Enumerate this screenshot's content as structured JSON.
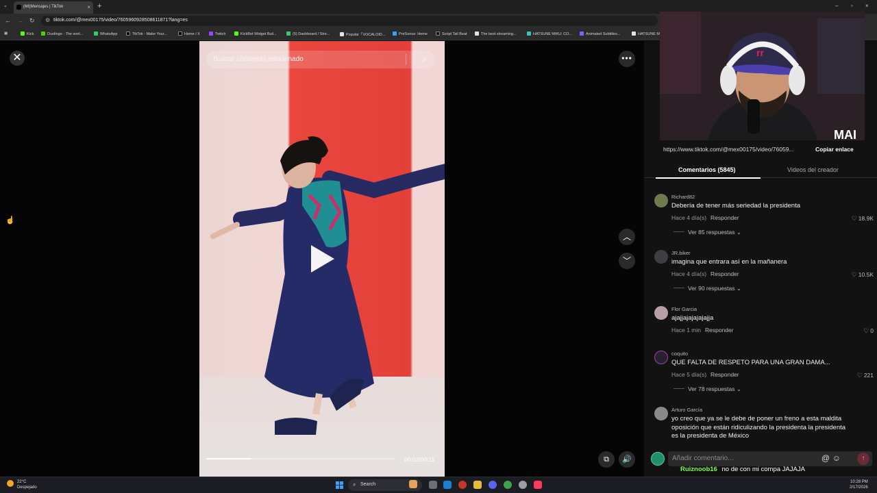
{
  "browser": {
    "tab_title": "(66)Mensajes | TikTok",
    "tab_close": "×",
    "new_tab": "+",
    "url": "tiktok.com/@mex00175/video/7605960928508611871?lang=es",
    "window_controls": [
      "–",
      "▫",
      "×"
    ],
    "bookmarks": [
      {
        "label": "Kick",
        "color": "#53fc18"
      },
      {
        "label": "Duolingo - The worl...",
        "color": "#58cc02"
      },
      {
        "label": "WhatsApp",
        "color": "#25d366"
      },
      {
        "label": "TikTok - Make Your...",
        "color": "#000000"
      },
      {
        "label": "Home / X",
        "color": "#000000"
      },
      {
        "label": "Twitch",
        "color": "#9146ff"
      },
      {
        "label": "KickBot Widget Buil...",
        "color": "#53fc18"
      },
      {
        "label": "(5) Dashboard / Stre...",
        "color": "#3ec46d"
      },
      {
        "label": "Popular「VOCALOID...",
        "color": "#e2e2e2"
      },
      {
        "label": "PreSonus: Home",
        "color": "#3aa0ff"
      },
      {
        "label": "Script Tail Beat",
        "color": "#111111"
      },
      {
        "label": "The best streaming...",
        "color": "#e2e2e2"
      },
      {
        "label": "HATSUNE MIKU: CO...",
        "color": "#39c5bb"
      },
      {
        "label": "Animated Subtitles...",
        "color": "#8a5cff"
      },
      {
        "label": "HATSUNE M",
        "color": "#e2e2e2"
      }
    ]
  },
  "video": {
    "search_placeholder": "Buscar contenido relacionado",
    "time": "00:02/00:11",
    "progress": 0.24
  },
  "webcam": {
    "cap_text": "rr",
    "overlay_text": "MAI"
  },
  "share": {
    "url": "https://www.tiktok.com/@mex00175/video/76059...",
    "copy_label": "Copiar enlace"
  },
  "tabs": {
    "comments": "Comentarios (5845)",
    "creator_videos": "Videos del creador"
  },
  "comments": [
    {
      "author": "Richard82",
      "text": "Debería de tener más seriedad la presidenta",
      "age": "Hace 4 día(s)",
      "reply": "Responder",
      "likes": "18.9K",
      "replies": "Ver 85 respuestas",
      "avatar_color": "#6d7a4c"
    },
    {
      "author": "JR.biker",
      "text": "imagina que entrara así en la mañanera",
      "age": "Hace 4 día(s)",
      "reply": "Responder",
      "likes": "10.5K",
      "replies": "Ver 90 respuestas",
      "avatar_color": "#3d3f42"
    },
    {
      "author": "Flor Garcia",
      "text": "ajajjajajajajajja",
      "age": "Hace 1 min",
      "reply": "Responder",
      "likes": "0",
      "replies": "",
      "avatar_color": "#b89ea8"
    },
    {
      "author": "coquito",
      "text": "QUE FALTA DE RESPETO PARA UNA GRAN DAMA...",
      "age": "Hace 5 día(s)",
      "reply": "Responder",
      "likes": "221",
      "replies": "Ver 78 respuestas",
      "avatar_color": "#2a2130"
    },
    {
      "author": "Arturo García",
      "text": "yo creo que ya se le debe de poner un freno a esta maldita oposición que están ridiculizando la presidenta la presidenta es la presidenta de México",
      "age": "",
      "reply": "",
      "likes": "",
      "replies": "",
      "avatar_color": "#8a8a8a"
    }
  ],
  "comment_input": {
    "placeholder": "Añadir comentario...",
    "at": "@",
    "emoji": "☺"
  },
  "chat_overlay": {
    "user": "Ruiznoob16",
    "message": "no de con mi compa JAJAJA"
  },
  "taskbar": {
    "temperature": "22°C",
    "condition": "Despejado",
    "search_label": "Search",
    "time": "10:28 PM",
    "date": "2/17/2026"
  }
}
